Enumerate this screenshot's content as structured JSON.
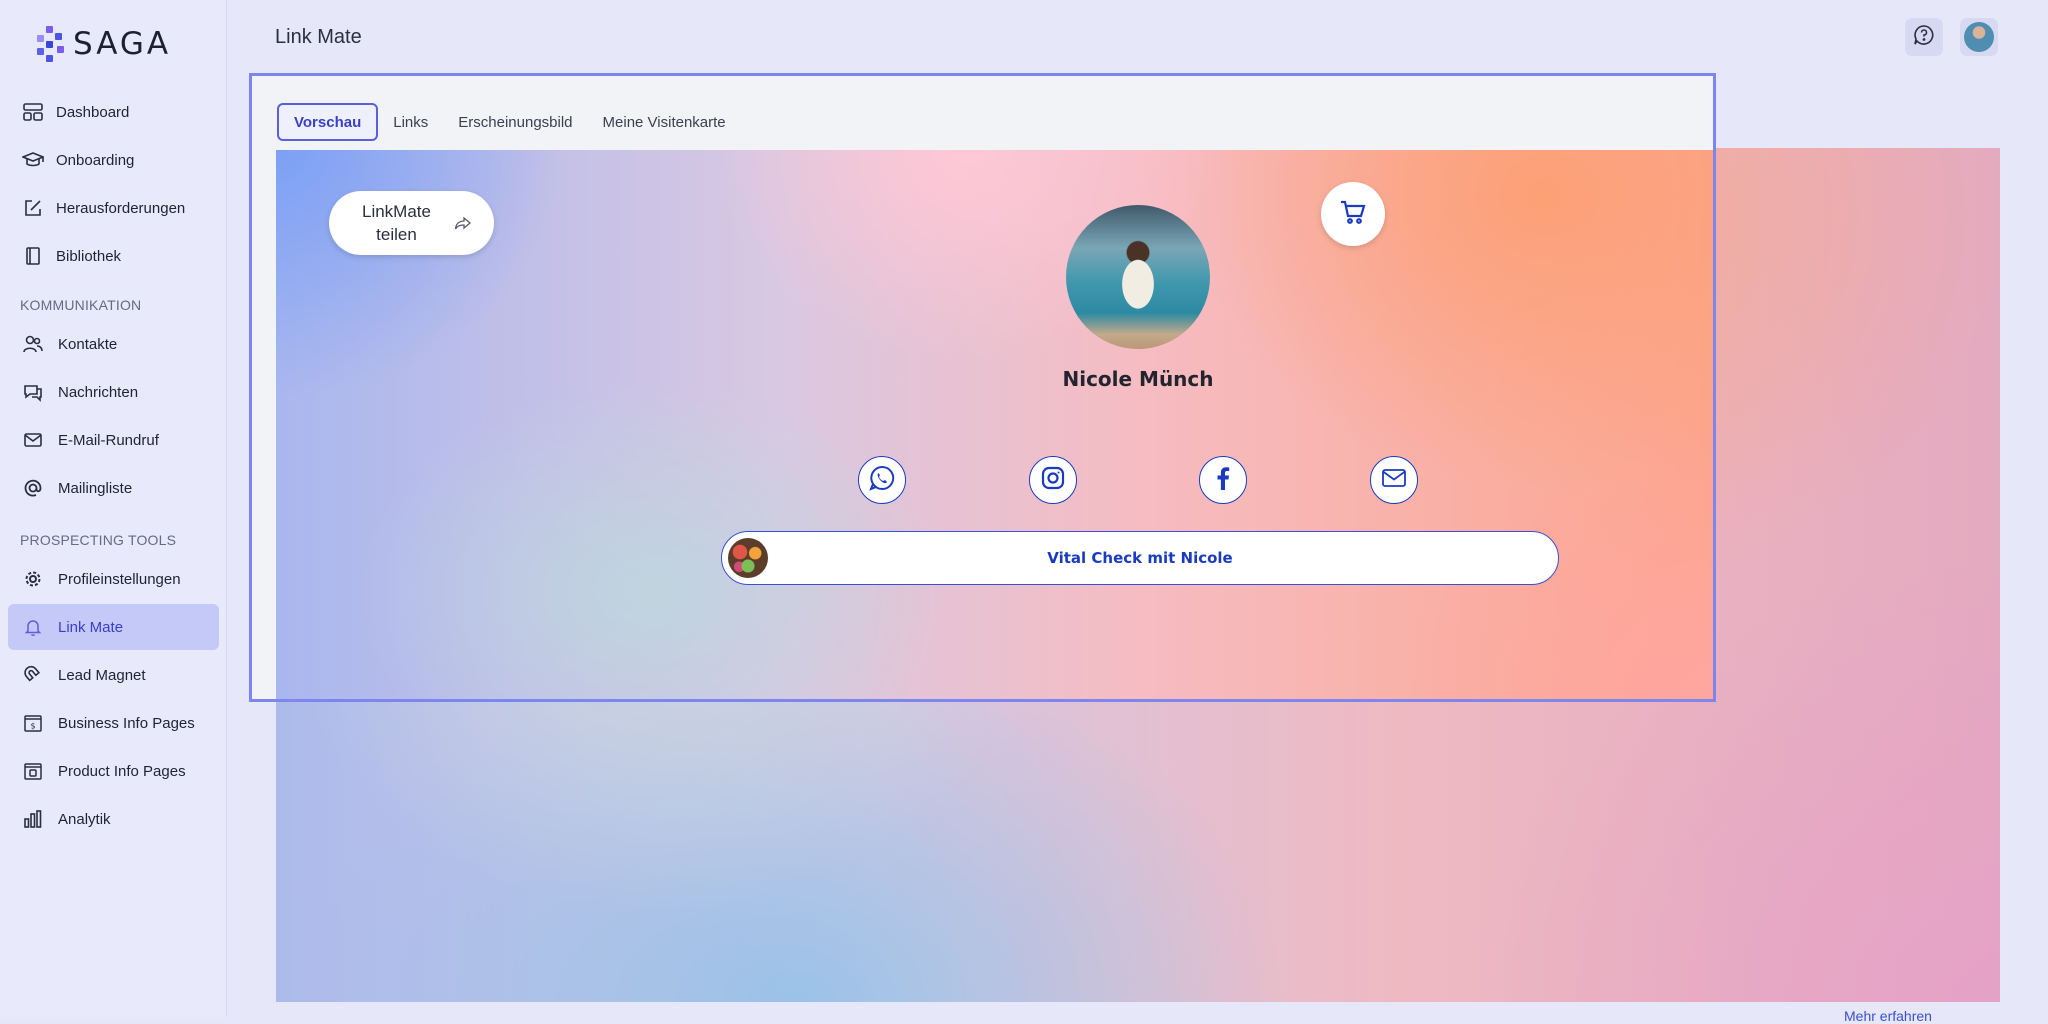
{
  "app": {
    "logo_text": "SAGA",
    "page_title": "Link Mate"
  },
  "colors": {
    "accent": "#5b5fd9",
    "active_nav_bg": "#c4c9f7",
    "focus_frame": "#7d86ee",
    "link_blue": "#1a3bc0"
  },
  "sidebar": {
    "items_top": [
      {
        "label": "Dashboard",
        "icon": "dashboard-icon"
      },
      {
        "label": "Onboarding",
        "icon": "graduation-cap-icon"
      },
      {
        "label": "Herausforderungen",
        "icon": "edit-square-icon"
      },
      {
        "label": "Bibliothek",
        "icon": "book-icon"
      }
    ],
    "section_comm": "KOMMUNIKATION",
    "items_comm": [
      {
        "label": "Kontakte",
        "icon": "users-icon"
      },
      {
        "label": "Nachrichten",
        "icon": "chat-icon"
      },
      {
        "label": "E-Mail-Rundruf",
        "icon": "mail-icon"
      },
      {
        "label": "Mailingliste",
        "icon": "at-icon"
      }
    ],
    "section_tools": "PROSPECTING TOOLS",
    "items_tools": [
      {
        "label": "Profileinstellungen",
        "icon": "gear-icon"
      },
      {
        "label": "Link Mate",
        "icon": "bell-icon",
        "active": true
      },
      {
        "label": "Lead Magnet",
        "icon": "magnet-icon"
      },
      {
        "label": "Business Info Pages",
        "icon": "dollar-page-icon"
      },
      {
        "label": "Product Info Pages",
        "icon": "product-page-icon"
      },
      {
        "label": "Analytik",
        "icon": "bar-chart-icon"
      }
    ]
  },
  "header": {
    "help_icon": "help-chat-icon",
    "avatar_icon": "user-avatar"
  },
  "tabs": [
    {
      "label": "Vorschau",
      "active": true
    },
    {
      "label": "Links"
    },
    {
      "label": "Erscheinungsbild"
    },
    {
      "label": "Meine Visitenkarte"
    }
  ],
  "preview": {
    "share_label": "LinkMate teilen",
    "profile_name": "Nicole Münch",
    "socials": [
      "whatsapp-icon",
      "instagram-icon",
      "facebook-icon",
      "mail-icon"
    ],
    "link_label": "Vital Check mit Nicole"
  },
  "footer": {
    "link_text": "Mehr erfahren"
  }
}
